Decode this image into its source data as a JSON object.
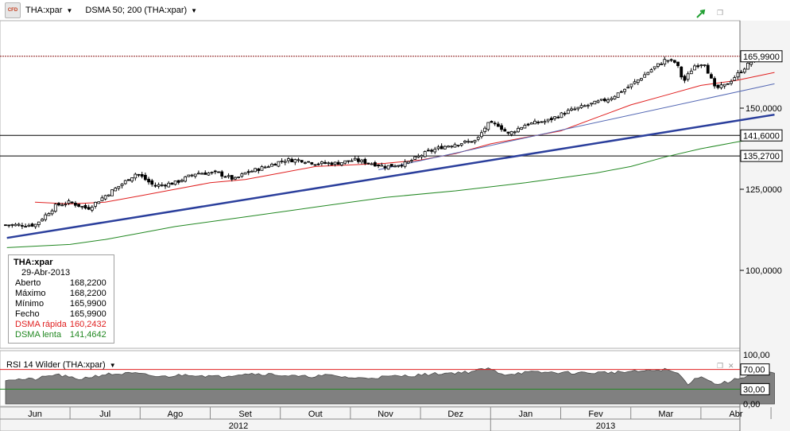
{
  "toolbar": {
    "symbol": "THA:xpar",
    "indicator": "DSMA 50; 200 (THA:xpar)"
  },
  "colors": {
    "candle_up": "#ffffff",
    "candle_down": "#000000",
    "fast_ma": "#e02020",
    "slow_ma": "#228822",
    "trend": "#2b3f9c",
    "rsi_fill": "#808080",
    "rsi_upper": "#e02020",
    "rsi_lower": "#228822"
  },
  "info_box": {
    "title": "THA:xpar",
    "date": "29-Abr-2013",
    "rows": [
      {
        "label": "Aberto",
        "value": "168,2200",
        "color": "#000000"
      },
      {
        "label": "Máximo",
        "value": "168,2200",
        "color": "#000000"
      },
      {
        "label": "Mínimo",
        "value": "165,9900",
        "color": "#000000"
      },
      {
        "label": "Fecho",
        "value": "165,9900",
        "color": "#000000"
      },
      {
        "label": "DSMA rápida",
        "value": "160,2432",
        "color": "#e02020"
      },
      {
        "label": "DSMA lenta",
        "value": "141,4642",
        "color": "#228822"
      }
    ]
  },
  "chart_data": [
    {
      "type": "candlestick",
      "title": "",
      "ylim": [
        95,
        170
      ],
      "y_ticks": [
        {
          "value": 100,
          "label": "100,0000"
        },
        {
          "value": 125,
          "label": "125,0000"
        },
        {
          "value": 150,
          "label": "150,0000"
        }
      ],
      "y_markers": [
        {
          "value": 165.99,
          "label": "165,9900",
          "style": "price"
        },
        {
          "value": 141.6,
          "label": "141,6000",
          "style": "hline"
        },
        {
          "value": 135.27,
          "label": "135,2700",
          "style": "hline"
        }
      ],
      "x_months": [
        "Jun",
        "Jul",
        "Ago",
        "Set",
        "Out",
        "Nov",
        "Dez",
        "Jan",
        "Fev",
        "Mar",
        "Abr"
      ],
      "x_years": [
        "2012",
        "2013"
      ],
      "close_anchors": [
        {
          "m": 0.0,
          "v": 114
        },
        {
          "m": 0.3,
          "v": 120
        },
        {
          "m": 0.5,
          "v": 121
        },
        {
          "m": 0.75,
          "v": 119
        },
        {
          "m": 1.0,
          "v": 123
        },
        {
          "m": 1.2,
          "v": 126
        },
        {
          "m": 1.45,
          "v": 130
        },
        {
          "m": 1.7,
          "v": 126
        },
        {
          "m": 2.0,
          "v": 127
        },
        {
          "m": 2.3,
          "v": 130
        },
        {
          "m": 2.6,
          "v": 130
        },
        {
          "m": 2.85,
          "v": 128
        },
        {
          "m": 3.0,
          "v": 130
        },
        {
          "m": 3.3,
          "v": 132
        },
        {
          "m": 3.55,
          "v": 134
        },
        {
          "m": 3.8,
          "v": 134
        },
        {
          "m": 4.0,
          "v": 133
        },
        {
          "m": 4.3,
          "v": 133
        },
        {
          "m": 4.55,
          "v": 134
        },
        {
          "m": 4.8,
          "v": 133
        },
        {
          "m": 5.0,
          "v": 132
        },
        {
          "m": 5.3,
          "v": 133
        },
        {
          "m": 5.55,
          "v": 136
        },
        {
          "m": 5.8,
          "v": 138
        },
        {
          "m": 6.0,
          "v": 139
        },
        {
          "m": 6.3,
          "v": 140
        },
        {
          "m": 6.45,
          "v": 145
        },
        {
          "m": 6.6,
          "v": 145
        },
        {
          "m": 6.75,
          "v": 142
        },
        {
          "m": 7.0,
          "v": 145
        },
        {
          "m": 7.3,
          "v": 146
        },
        {
          "m": 7.6,
          "v": 149
        },
        {
          "m": 7.9,
          "v": 151
        },
        {
          "m": 8.2,
          "v": 153
        },
        {
          "m": 8.5,
          "v": 157
        },
        {
          "m": 8.8,
          "v": 162
        },
        {
          "m": 9.0,
          "v": 165
        },
        {
          "m": 9.15,
          "v": 164
        },
        {
          "m": 9.25,
          "v": 158
        },
        {
          "m": 9.4,
          "v": 163
        },
        {
          "m": 9.55,
          "v": 164
        },
        {
          "m": 9.7,
          "v": 156
        },
        {
          "m": 9.85,
          "v": 157
        },
        {
          "m": 10.0,
          "v": 160
        },
        {
          "m": 10.2,
          "v": 164
        },
        {
          "m": 10.4,
          "v": 167
        },
        {
          "m": 10.55,
          "v": 166
        }
      ],
      "series": [
        {
          "name": "DSMA rápida",
          "color": "#e02020",
          "points": [
            {
              "m": 0,
              "v": 121
            },
            {
              "m": 0.5,
              "v": 120.5
            },
            {
              "m": 1,
              "v": 121
            },
            {
              "m": 1.5,
              "v": 123
            },
            {
              "m": 2,
              "v": 125
            },
            {
              "m": 2.5,
              "v": 127
            },
            {
              "m": 3,
              "v": 128
            },
            {
              "m": 3.5,
              "v": 130
            },
            {
              "m": 4,
              "v": 132
            },
            {
              "m": 4.5,
              "v": 132.5
            },
            {
              "m": 5,
              "v": 133
            },
            {
              "m": 5.5,
              "v": 134
            },
            {
              "m": 6,
              "v": 136
            },
            {
              "m": 6.5,
              "v": 139
            },
            {
              "m": 7,
              "v": 141
            },
            {
              "m": 7.5,
              "v": 143
            },
            {
              "m": 8,
              "v": 147
            },
            {
              "m": 8.5,
              "v": 151
            },
            {
              "m": 9,
              "v": 154
            },
            {
              "m": 9.5,
              "v": 157
            },
            {
              "m": 10,
              "v": 158.5
            },
            {
              "m": 10.55,
              "v": 161
            }
          ]
        },
        {
          "name": "DSMA lenta",
          "color": "#228822",
          "points": [
            {
              "m": -0.4,
              "v": 107
            },
            {
              "m": 0.5,
              "v": 108
            },
            {
              "m": 1,
              "v": 109.5
            },
            {
              "m": 1.5,
              "v": 111.5
            },
            {
              "m": 2,
              "v": 113.5
            },
            {
              "m": 3,
              "v": 116.5
            },
            {
              "m": 4,
              "v": 119.5
            },
            {
              "m": 5,
              "v": 122.5
            },
            {
              "m": 6,
              "v": 124.5
            },
            {
              "m": 7,
              "v": 127
            },
            {
              "m": 8,
              "v": 130
            },
            {
              "m": 8.5,
              "v": 132
            },
            {
              "m": 9,
              "v": 135
            },
            {
              "m": 9.5,
              "v": 137.5
            },
            {
              "m": 10,
              "v": 139.5
            },
            {
              "m": 10.55,
              "v": 141.6
            }
          ]
        },
        {
          "name": "trend-thick",
          "color": "#2b3f9c",
          "points": [
            {
              "m": -0.4,
              "v": 110
            },
            {
              "m": 10.55,
              "v": 148
            }
          ]
        },
        {
          "name": "trend-thin",
          "color": "#5468b4",
          "points": [
            {
              "m": 4.9,
              "v": 131
            },
            {
              "m": 10.55,
              "v": 157.5
            }
          ]
        }
      ]
    },
    {
      "type": "area",
      "title": "RSI 14 Wilder (THA:xpar)",
      "ylim": [
        0,
        100
      ],
      "y_ticks": [
        {
          "value": 100,
          "label": "100,00"
        },
        {
          "value": 70,
          "label": "70,00"
        },
        {
          "value": 30,
          "label": "30,00"
        },
        {
          "value": 0,
          "label": "0,00"
        }
      ],
      "levels": [
        70,
        30
      ],
      "values_anchors": [
        {
          "m": 0.0,
          "v": 50
        },
        {
          "m": 0.3,
          "v": 60
        },
        {
          "m": 0.6,
          "v": 50
        },
        {
          "m": 1.0,
          "v": 60
        },
        {
          "m": 1.4,
          "v": 62
        },
        {
          "m": 1.8,
          "v": 55
        },
        {
          "m": 2.2,
          "v": 60
        },
        {
          "m": 2.6,
          "v": 55
        },
        {
          "m": 3.0,
          "v": 62
        },
        {
          "m": 3.4,
          "v": 60
        },
        {
          "m": 3.8,
          "v": 55
        },
        {
          "m": 4.2,
          "v": 58
        },
        {
          "m": 4.6,
          "v": 52
        },
        {
          "m": 5.0,
          "v": 55
        },
        {
          "m": 5.4,
          "v": 58
        },
        {
          "m": 5.8,
          "v": 62
        },
        {
          "m": 6.2,
          "v": 65
        },
        {
          "m": 6.45,
          "v": 72
        },
        {
          "m": 6.7,
          "v": 60
        },
        {
          "m": 7.0,
          "v": 64
        },
        {
          "m": 7.4,
          "v": 64
        },
        {
          "m": 7.8,
          "v": 63
        },
        {
          "m": 8.2,
          "v": 64
        },
        {
          "m": 8.6,
          "v": 66
        },
        {
          "m": 9.0,
          "v": 70
        },
        {
          "m": 9.2,
          "v": 60
        },
        {
          "m": 9.3,
          "v": 40
        },
        {
          "m": 9.5,
          "v": 58
        },
        {
          "m": 9.7,
          "v": 40
        },
        {
          "m": 9.9,
          "v": 45
        },
        {
          "m": 10.1,
          "v": 55
        },
        {
          "m": 10.35,
          "v": 65
        },
        {
          "m": 10.55,
          "v": 62
        }
      ]
    }
  ]
}
